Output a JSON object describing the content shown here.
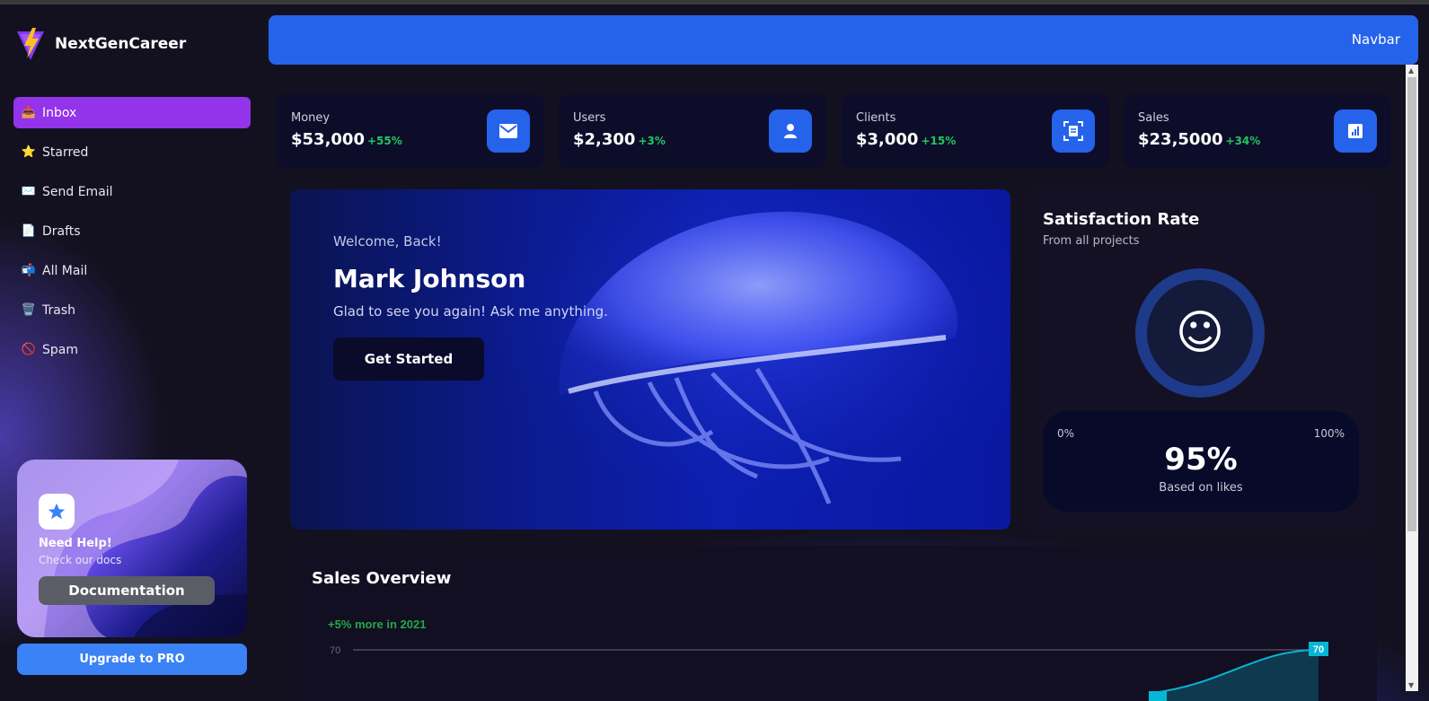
{
  "brand": {
    "name": "NextGenCareer"
  },
  "navbar": {
    "title": "Navbar"
  },
  "sidebar": {
    "items": [
      {
        "emoji": "📥",
        "label": "Inbox",
        "active": true
      },
      {
        "emoji": "⭐",
        "label": "Starred"
      },
      {
        "emoji": "✉️",
        "label": "Send Email"
      },
      {
        "emoji": "📄",
        "label": "Drafts"
      },
      {
        "emoji": "📬",
        "label": "All Mail"
      },
      {
        "emoji": "🗑️",
        "label": "Trash"
      },
      {
        "emoji": "🚫",
        "label": "Spam"
      }
    ],
    "help": {
      "title": "Need Help!",
      "subtitle": "Check our docs",
      "button": "Documentation",
      "icon": "star-icon"
    },
    "upgrade": "Upgrade to PRO"
  },
  "stats": [
    {
      "label": "Money",
      "value": "$53,000",
      "change": "+55%",
      "icon": "mail-icon"
    },
    {
      "label": "Users",
      "value": "$2,300",
      "change": "+3%",
      "icon": "user-icon"
    },
    {
      "label": "Clients",
      "value": "$3,000",
      "change": "+15%",
      "icon": "document-scan-icon"
    },
    {
      "label": "Sales",
      "value": "$23,5000",
      "change": "+34%",
      "icon": "chart-icon"
    }
  ],
  "hero": {
    "welcome": "Welcome, Back!",
    "name": "Mark Johnson",
    "subtitle": "Glad to see you again! Ask me anything.",
    "button": "Get Started"
  },
  "satisfaction": {
    "title": "Satisfaction Rate",
    "subtitle": "From all projects",
    "emoji": "☺",
    "min": "0%",
    "max": "100%",
    "value": "95%",
    "note": "Based on likes"
  },
  "sales": {
    "title": "Sales Overview",
    "subtitle": "+5% more in 2021"
  },
  "colors": {
    "accent": "#2563eb",
    "active": "#9333ea",
    "positive": "#22c55e",
    "line": "#06b6d4"
  },
  "chart_data": {
    "type": "area",
    "y_ticks": [
      "70"
    ],
    "data_labels": [
      "70"
    ],
    "series": [
      {
        "values": [
          55,
          70
        ]
      }
    ]
  }
}
